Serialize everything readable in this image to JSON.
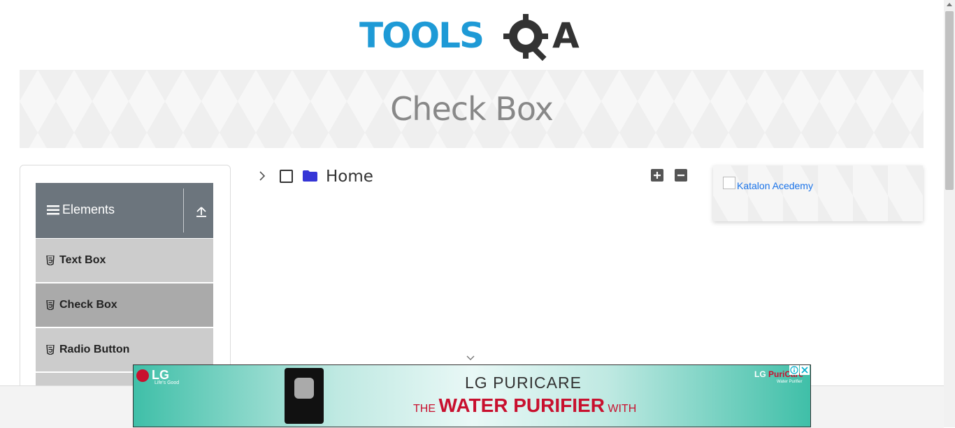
{
  "brand": {
    "logo_text": "TOOLSQA",
    "primary_color": "#1e9ad6",
    "dark_color": "#333333"
  },
  "page": {
    "title": "Check Box"
  },
  "sidebar": {
    "group_title": "Elements",
    "items": [
      {
        "label": "Text Box",
        "active": false
      },
      {
        "label": "Check Box",
        "active": true
      },
      {
        "label": "Radio Button",
        "active": false
      }
    ]
  },
  "tree": {
    "root_label": "Home",
    "checked": false,
    "expanded": false,
    "folder_color": "#3535d6"
  },
  "side_ad": {
    "alt_text": "Katalon Acedemy"
  },
  "bottom_ad": {
    "brand": "LG",
    "brand_tagline": "Life's Good",
    "headline": "LG  PURICARE",
    "tagline_pre": "THE ",
    "tagline_main": "WATER PURIFIER",
    "tagline_post": " WITH",
    "right_brand": "LG ",
    "right_brand_product": "PuriCare",
    "right_sub": "Water Purifier"
  }
}
